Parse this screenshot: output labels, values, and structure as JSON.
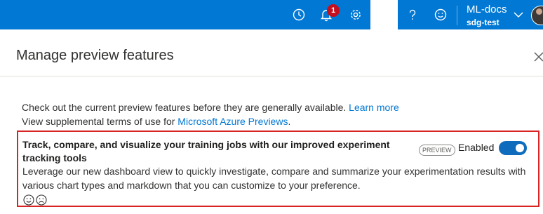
{
  "header": {
    "notification_count": "1",
    "account_name": "ML-docs",
    "account_directory": "sdg-test",
    "icons": [
      "clock-icon",
      "bell-icon",
      "gear-icon",
      "help-icon",
      "feedback-smiley-icon",
      "chevron-down-icon",
      "avatar"
    ]
  },
  "panel": {
    "title": "Manage preview features",
    "intro_line1": "Check out the current preview features before they are generally available.",
    "learn_more": "Learn more",
    "intro_line2": "View supplemental terms of use for",
    "previews_link": "Microsoft Azure Previews",
    "period": "."
  },
  "feature": {
    "title": "Track, compare, and visualize your training jobs with our improved experiment tracking tools",
    "tag": "PREVIEW",
    "status_label": "Enabled",
    "enabled": true,
    "description": "Leverage our new dashboard view to quickly investigate, compare and summarize your experimentation results with various chart types and markdown that you can customize to your preference."
  },
  "colors": {
    "brand": "#0078d4",
    "highlight_border": "#d92424",
    "badge": "#c50f1f"
  }
}
